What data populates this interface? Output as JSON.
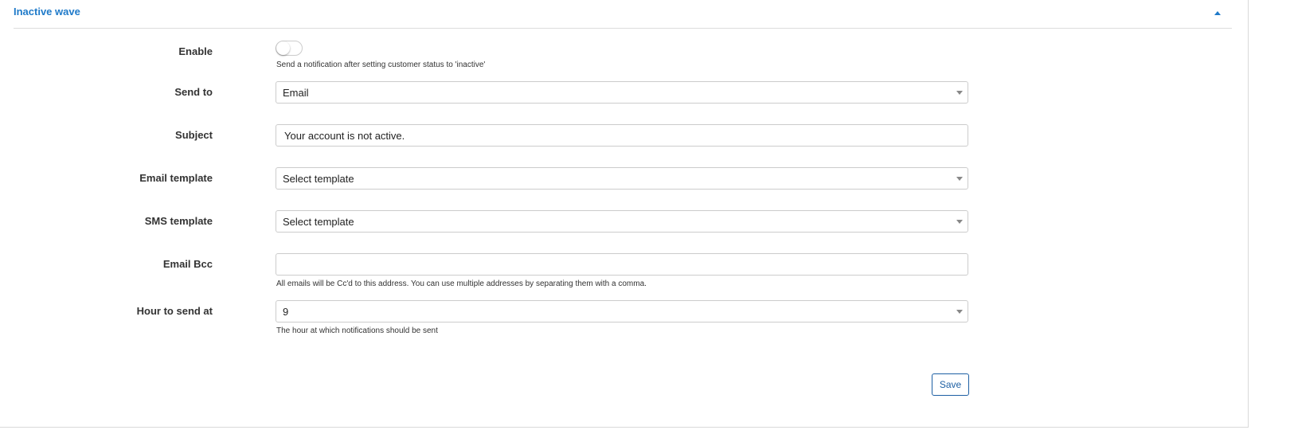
{
  "panel": {
    "title": "Inactive wave",
    "accent_color": "#1f7ac9",
    "collapse_icon": "caret-up-icon"
  },
  "form": {
    "enable": {
      "label": "Enable",
      "checked": false,
      "help": "Send a notification after setting customer status to 'inactive'"
    },
    "send_to": {
      "label": "Send to",
      "value": "Email"
    },
    "subject": {
      "label": "Subject",
      "value": "Your account is not active."
    },
    "email_template": {
      "label": "Email template",
      "value": "Select template"
    },
    "sms_template": {
      "label": "SMS template",
      "value": "Select template"
    },
    "email_bcc": {
      "label": "Email Bcc",
      "value": "",
      "help": "All emails will be Cc'd to this address. You can use multiple addresses by separating them with a comma."
    },
    "hour_to_send": {
      "label": "Hour to send at",
      "value": "9",
      "help": "The hour at which notifications should be sent"
    },
    "save_label": "Save"
  }
}
